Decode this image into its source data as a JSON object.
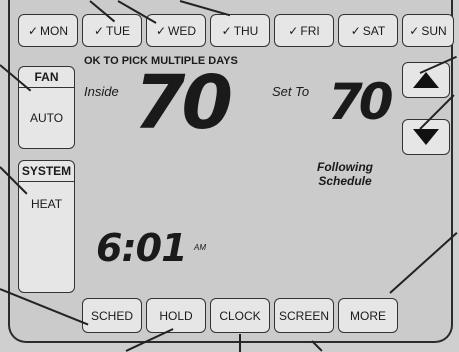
{
  "days": [
    {
      "check": "✓",
      "label": "MON"
    },
    {
      "check": "✓",
      "label": "TUE"
    },
    {
      "check": "✓",
      "label": "WED"
    },
    {
      "check": "✓",
      "label": "THU"
    },
    {
      "check": "✓",
      "label": "FRI"
    },
    {
      "check": "✓",
      "label": "SAT"
    },
    {
      "check": "✓",
      "label": "SUN"
    }
  ],
  "hint": "OK TO PICK MULTIPLE DAYS",
  "fan": {
    "label": "FAN",
    "value": "AUTO"
  },
  "system": {
    "label": "SYSTEM",
    "value": "HEAT"
  },
  "inside": {
    "label": "Inside",
    "temp": "70"
  },
  "setpoint": {
    "label": "Set To",
    "temp": "70"
  },
  "status": {
    "line1": "Following",
    "line2": "Schedule"
  },
  "clock": {
    "time": "6:01",
    "ampm": "AM"
  },
  "arrows": {
    "up": "up-arrow-icon",
    "down": "down-arrow-icon"
  },
  "buttons": {
    "sched": "SCHED",
    "hold": "HOLD",
    "clock": "CLOCK",
    "screen": "SCREEN",
    "more": "MORE"
  }
}
